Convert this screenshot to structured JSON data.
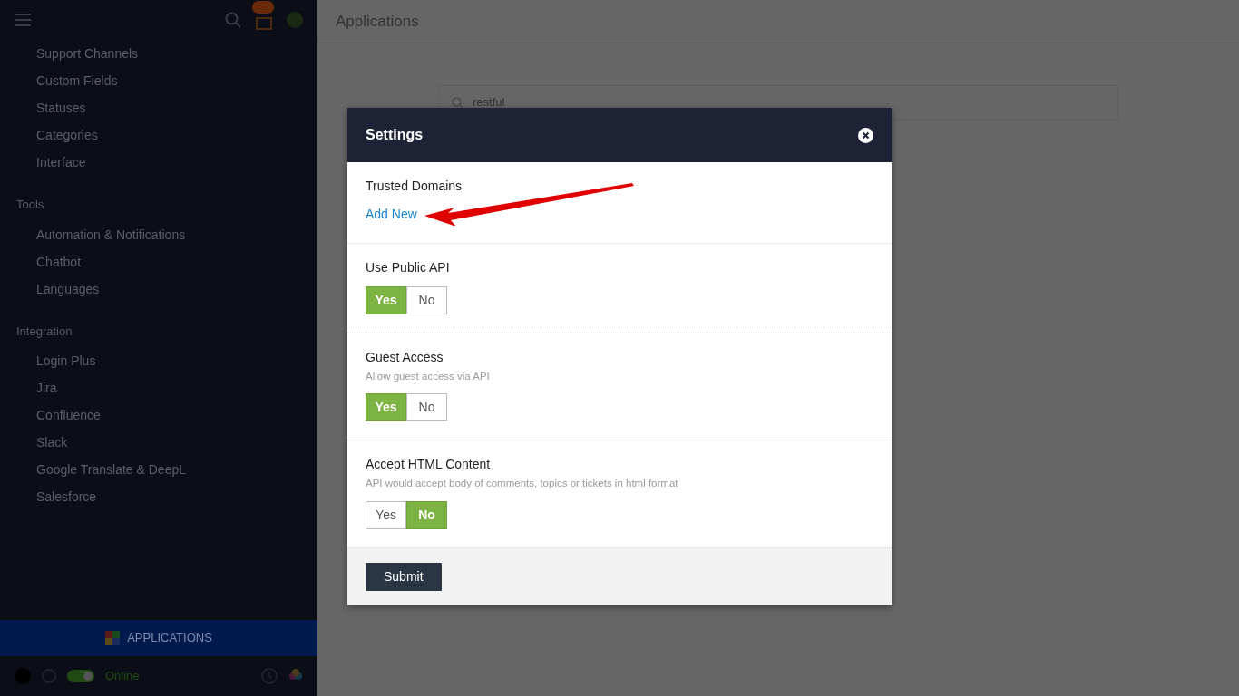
{
  "sidebar": {
    "groups": [
      {
        "items": [
          "Support Channels",
          "Custom Fields",
          "Statuses",
          "Categories",
          "Interface"
        ]
      },
      {
        "heading": "Tools",
        "items": [
          "Automation & Notifications",
          "Chatbot",
          "Languages"
        ]
      },
      {
        "heading": "Integration",
        "items": [
          "Login Plus",
          "Jira",
          "Confluence",
          "Slack",
          "Google Translate & DeepL",
          "Salesforce"
        ]
      }
    ],
    "active_item": {
      "label": "APPLICATIONS"
    },
    "status": {
      "online": true,
      "label": "Online"
    }
  },
  "page": {
    "title": "Applications",
    "search": {
      "value": "restful"
    }
  },
  "modal": {
    "title": "Settings",
    "sections": [
      {
        "kind": "link",
        "label": "Trusted Domains",
        "link": "Add New"
      },
      {
        "kind": "toggle",
        "label": "Use Public API",
        "options": [
          {
            "label": "Yes",
            "selected": true
          },
          {
            "label": "No",
            "selected": false
          }
        ]
      },
      {
        "kind": "toggle",
        "label": "Guest Access",
        "hint": "Allow guest access via API",
        "options": [
          {
            "label": "Yes",
            "selected": true
          },
          {
            "label": "No",
            "selected": false
          }
        ]
      },
      {
        "kind": "toggle",
        "label": "Accept HTML Content",
        "hint": "API would accept body of comments, topics or tickets in html format",
        "options": [
          {
            "label": "Yes",
            "selected": false
          },
          {
            "label": "No",
            "selected": true
          }
        ]
      }
    ],
    "submit": "Submit"
  }
}
